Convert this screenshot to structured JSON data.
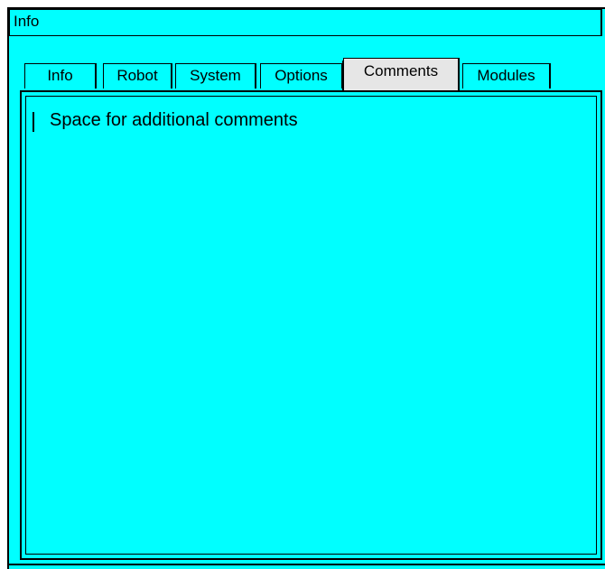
{
  "window": {
    "title": "Info"
  },
  "tabs": [
    {
      "label": "Info",
      "active": false
    },
    {
      "label": "Robot",
      "active": false
    },
    {
      "label": "System",
      "active": false
    },
    {
      "label": "Options",
      "active": false
    },
    {
      "label": "Comments",
      "active": true
    },
    {
      "label": "Modules",
      "active": false
    }
  ],
  "comments": {
    "text": "Space for additional comments"
  },
  "colors": {
    "background": "#00ffff",
    "active_tab": "#e6e6e6",
    "border": "#000000"
  }
}
